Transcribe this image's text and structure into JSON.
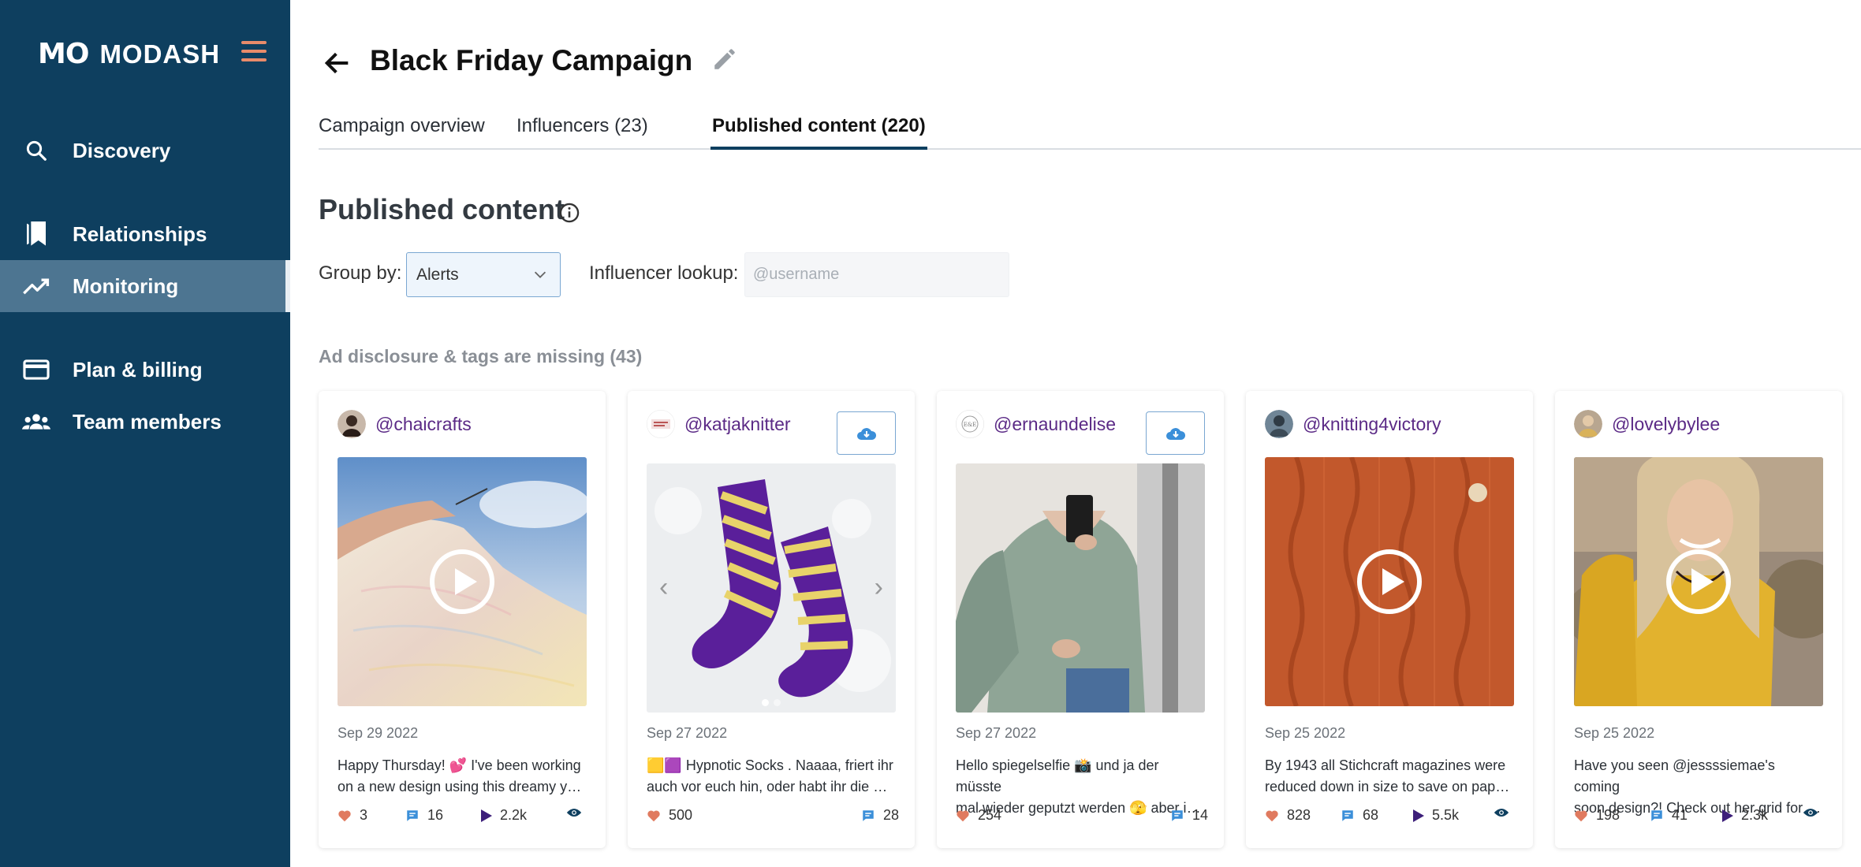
{
  "brand": {
    "logo_mark": "MO",
    "name": "MODASH"
  },
  "sidebar": {
    "items": [
      {
        "label": "Discovery",
        "icon": "search-icon"
      },
      {
        "label": "Relationships",
        "icon": "bookmark-icon"
      },
      {
        "label": "Monitoring",
        "icon": "trending-icon",
        "active": true
      },
      {
        "label": "Plan & billing",
        "icon": "credit-card-icon"
      },
      {
        "label": "Team members",
        "icon": "team-icon"
      }
    ]
  },
  "header": {
    "title": "Black Friday Campaign"
  },
  "tabs": [
    {
      "label": "Campaign overview"
    },
    {
      "label": "Influencers (23)"
    },
    {
      "label": "Published content (220)",
      "active": true
    }
  ],
  "content": {
    "heading": "Published content",
    "group_by_label": "Group by:",
    "group_by_value": "Alerts",
    "lookup_label": "Influencer lookup:",
    "lookup_placeholder": "@username",
    "group_heading": "Ad disclosure & tags are missing (43)"
  },
  "cards": [
    {
      "handle": "@chaicrafts",
      "date": "Sep 29 2022",
      "caption_1": "Happy Thursday! 💕 I've been working",
      "caption_2": "on a new design using this dreamy yarn from",
      "likes": "3",
      "comments": "16",
      "plays": "2.2k",
      "type": "video",
      "download": false
    },
    {
      "handle": "@katjaknitter",
      "date": "Sep 27 2022",
      "caption_1": "🟨🟪 Hypnotic Socks . Naaaa, friert ihr",
      "caption_2": "auch vor euch hin, oder habt ihr die Heizung",
      "likes": "500",
      "comments": "28",
      "type": "carousel",
      "download": true
    },
    {
      "handle": "@ernaundelise",
      "date": "Sep 27 2022",
      "caption_1": "Hello spiegelselfie 📸 und ja der müsste",
      "caption_2": "mal wieder geputzt werden 🫣 aber ich habe",
      "likes": "254",
      "comments": "14",
      "type": "image",
      "download": true
    },
    {
      "handle": "@knitting4victory",
      "date": "Sep 25 2022",
      "caption_1": "By 1943 all Stichcraft magazines were",
      "caption_2": "reduced down in size to save on paper and ink",
      "likes": "828",
      "comments": "68",
      "plays": "5.5k",
      "type": "video",
      "download": false
    },
    {
      "handle": "@lovelybylee",
      "date": "Sep 25 2022",
      "caption_1": "Have you seen @jessssiemae's coming",
      "caption_2": "soon design?! Check out her grid for more",
      "likes": "198",
      "comments": "41",
      "plays": "2.3k",
      "type": "video",
      "download": false
    }
  ],
  "colors": {
    "sidebar": "#0e3f5f",
    "active_nav": "#4d7591",
    "handle": "#5b2a86",
    "heart": "#e07a5f",
    "comment": "#3b8fd9",
    "play": "#3d1f7a",
    "accent_menu": "#e88b6a"
  }
}
